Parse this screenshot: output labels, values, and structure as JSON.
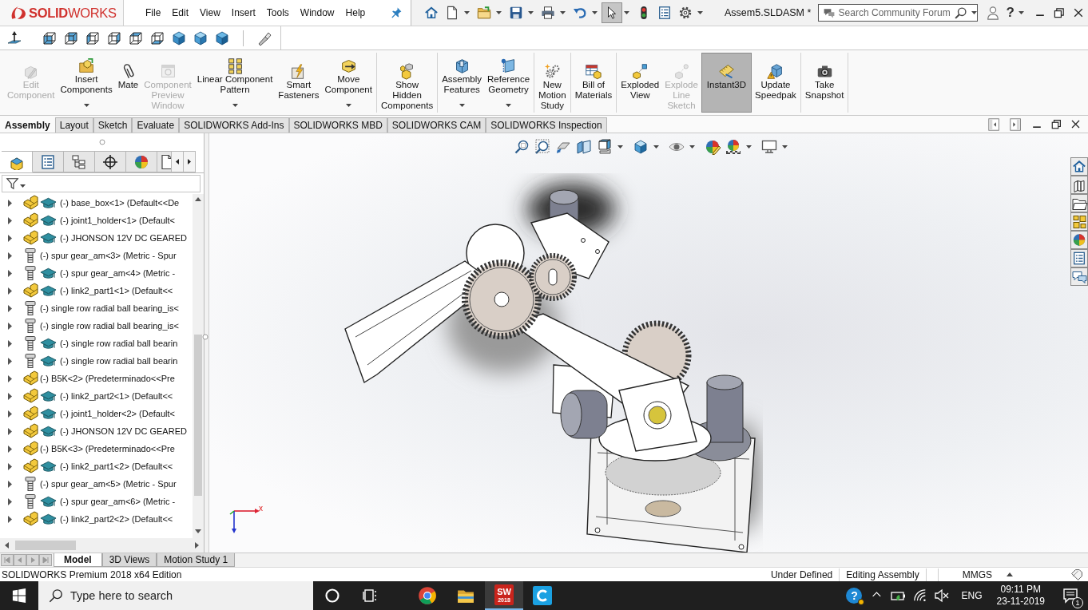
{
  "title_bar": {
    "logo": "**SOLID**WORKS",
    "menu": [
      "File",
      "Edit",
      "View",
      "Insert",
      "Tools",
      "Window",
      "Help"
    ],
    "quick_access": [
      {
        "dropdown": false,
        "selected": false
      },
      {
        "dropdown": true,
        "selected": false
      },
      {
        "dropdown": true,
        "selected": false
      },
      {
        "dropdown": true,
        "selected": false
      },
      {
        "dropdown": true,
        "selected": false
      },
      {
        "dropdown": true,
        "selected": false
      },
      {
        "dropdown": true,
        "selected": true
      },
      {
        "dropdown": false,
        "selected": false
      },
      {
        "dropdown": false,
        "selected": false
      },
      {
        "dropdown": true,
        "selected": false
      }
    ],
    "document_title": "Assem5.SLDASM *",
    "search": {
      "placeholder": "Search Community Forum"
    },
    "help_label": "?"
  },
  "command_manager": {
    "groups": [
      {
        "buttons": [
          {
            "label": "Edit\nComponent",
            "disabled": true,
            "dropdown": false,
            "on": false
          },
          {
            "label": "Insert\nComponents",
            "disabled": false,
            "dropdown": true,
            "on": false
          },
          {
            "label": "Mate",
            "disabled": false,
            "dropdown": false,
            "on": false
          },
          {
            "label": "Component\nPreview\nWindow",
            "disabled": true,
            "dropdown": false,
            "on": false
          },
          {
            "label": "Linear Component\nPattern",
            "disabled": false,
            "dropdown": true,
            "on": false
          },
          {
            "label": "Smart\nFasteners",
            "disabled": false,
            "dropdown": false,
            "on": false
          },
          {
            "label": "Move\nComponent",
            "disabled": false,
            "dropdown": true,
            "on": false
          }
        ]
      },
      {
        "buttons": [
          {
            "label": "Show\nHidden\nComponents",
            "disabled": false,
            "dropdown": false,
            "on": false
          }
        ]
      },
      {
        "buttons": [
          {
            "label": "Assembly\nFeatures",
            "disabled": false,
            "dropdown": true,
            "on": false
          },
          {
            "label": "Reference\nGeometry",
            "disabled": false,
            "dropdown": true,
            "on": false
          }
        ]
      },
      {
        "buttons": [
          {
            "label": "New\nMotion\nStudy",
            "disabled": false,
            "dropdown": false,
            "on": false
          }
        ]
      },
      {
        "buttons": [
          {
            "label": "Bill of\nMaterials",
            "disabled": false,
            "dropdown": false,
            "on": false
          }
        ]
      },
      {
        "buttons": [
          {
            "label": "Exploded\nView",
            "disabled": false,
            "dropdown": false,
            "on": false
          },
          {
            "label": "Explode\nLine\nSketch",
            "disabled": true,
            "dropdown": false,
            "on": false
          },
          {
            "label": "Instant3D",
            "disabled": false,
            "dropdown": false,
            "on": true
          },
          {
            "label": "Update\nSpeedpak",
            "disabled": false,
            "dropdown": false,
            "on": false
          }
        ]
      },
      {
        "buttons": [
          {
            "label": "Take\nSnapshot",
            "disabled": false,
            "dropdown": false,
            "on": false
          }
        ]
      }
    ]
  },
  "command_tabs": [
    {
      "label": "Assembly",
      "selected": true
    },
    {
      "label": "Layout",
      "selected": false
    },
    {
      "label": "Sketch",
      "selected": false
    },
    {
      "label": "Evaluate",
      "selected": false
    },
    {
      "label": "SOLIDWORKS Add-Ins",
      "selected": false
    },
    {
      "label": "SOLIDWORKS MBD",
      "selected": false
    },
    {
      "label": "SOLIDWORKS CAM",
      "selected": false
    },
    {
      "label": "SOLIDWORKS Inspection",
      "selected": false
    }
  ],
  "feature_tree": {
    "panel_tabs": [
      {
        "selected": true
      },
      {
        "selected": false
      },
      {
        "selected": false
      },
      {
        "selected": false
      },
      {
        "selected": false
      },
      {
        "selected": false
      }
    ],
    "items": [
      {
        "label": "(-) base_box<1> (Default<<De",
        "kind": "part",
        "educational": true,
        "expanded": false
      },
      {
        "label": "(-) joint1_holder<1> (Default<",
        "kind": "part",
        "educational": true,
        "expanded": false
      },
      {
        "label": "(-) JHONSON 12V DC GEARED",
        "kind": "part",
        "educational": true,
        "expanded": false
      },
      {
        "label": "(-) spur gear_am<3> (Metric - Spur",
        "kind": "toolbox",
        "educational": false,
        "expanded": false
      },
      {
        "label": "(-) spur gear_am<4> (Metric -",
        "kind": "toolbox",
        "educational": true,
        "expanded": false
      },
      {
        "label": "(-) link2_part1<1> (Default<<",
        "kind": "part",
        "educational": true,
        "expanded": false
      },
      {
        "label": "(-) single row radial ball bearing_is<",
        "kind": "toolbox",
        "educational": false,
        "expanded": false
      },
      {
        "label": "(-) single row radial ball bearing_is<",
        "kind": "toolbox",
        "educational": false,
        "expanded": false
      },
      {
        "label": "(-) single row radial ball bearin",
        "kind": "toolbox",
        "educational": true,
        "expanded": false
      },
      {
        "label": "(-) single row radial ball bearin",
        "kind": "toolbox",
        "educational": true,
        "expanded": false
      },
      {
        "label": "(-) B5K<2> (Predeterminado<<Pre",
        "kind": "part",
        "educational": false,
        "expanded": false
      },
      {
        "label": "(-) link2_part2<1> (Default<<",
        "kind": "part",
        "educational": true,
        "expanded": false
      },
      {
        "label": "(-) joint1_holder<2> (Default<",
        "kind": "part",
        "educational": true,
        "expanded": false
      },
      {
        "label": "(-) JHONSON 12V DC GEARED",
        "kind": "part",
        "educational": true,
        "expanded": false
      },
      {
        "label": "(-) B5K<3> (Predeterminado<<Pre",
        "kind": "part",
        "educational": false,
        "expanded": false
      },
      {
        "label": "(-) link2_part1<2> (Default<<",
        "kind": "part",
        "educational": true,
        "expanded": false
      },
      {
        "label": "(-) spur gear_am<5> (Metric - Spur",
        "kind": "toolbox",
        "educational": false,
        "expanded": false
      },
      {
        "label": "(-) spur gear_am<6> (Metric -",
        "kind": "toolbox",
        "educational": true,
        "expanded": false
      },
      {
        "label": "(-) link2_part2<2> (Default<<",
        "kind": "part",
        "educational": true,
        "expanded": false
      }
    ]
  },
  "viewport": {
    "triad_label": "x"
  },
  "bottom_tabs": [
    {
      "label": "Model",
      "selected": true
    },
    {
      "label": "3D Views",
      "selected": false
    },
    {
      "label": "Motion Study 1",
      "selected": false
    }
  ],
  "status_bar": {
    "edition": "SOLIDWORKS Premium 2018 x64 Edition",
    "sections": [
      "Under Defined",
      "Editing Assembly",
      "MMGS"
    ]
  },
  "taskbar": {
    "search": {
      "placeholder": "Type here to search"
    },
    "buttons": [
      {
        "kind": "ring",
        "selected": false
      },
      {
        "kind": "task_view",
        "selected": false
      },
      {
        "kind": "browser",
        "selected": false
      },
      {
        "kind": "folder",
        "selected": false
      },
      {
        "kind": "text_logo",
        "selected": true,
        "logo_text": "SW",
        "logo_subtext": "2018"
      },
      {
        "kind": "c_logo",
        "selected": false
      }
    ],
    "tray": {
      "help_label": "?",
      "language": "ENG",
      "time": "09:11 PM",
      "date": "23-11-2019",
      "notification_count": "1"
    }
  }
}
